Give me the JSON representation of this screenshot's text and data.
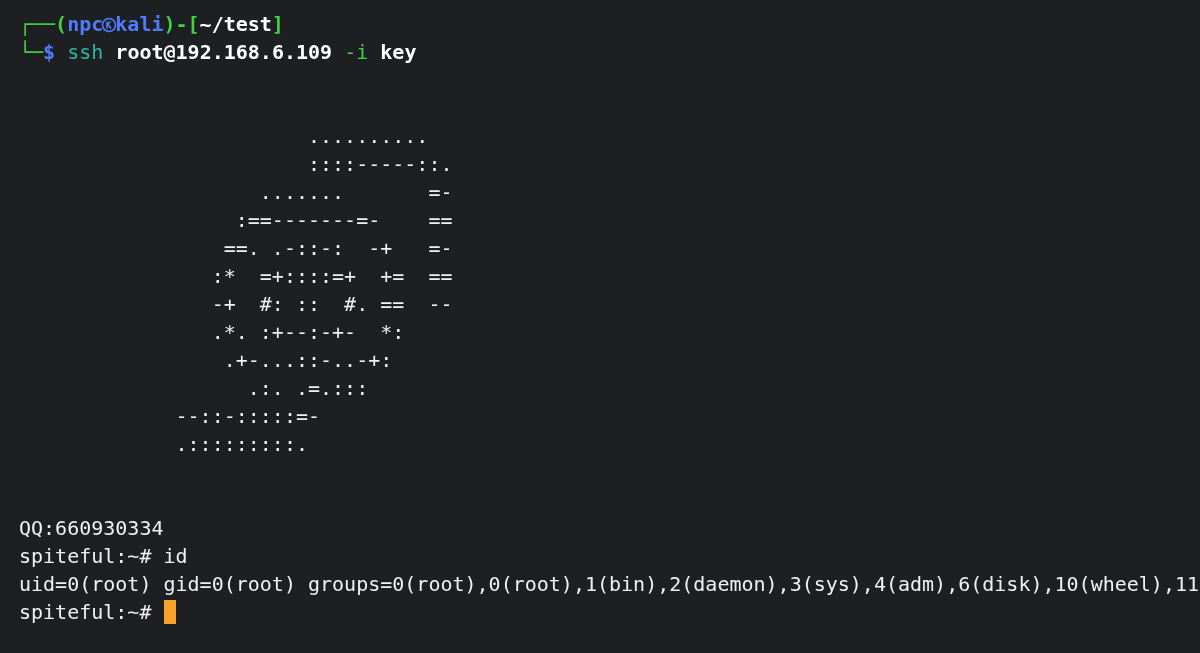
{
  "prompt": {
    "frame_top": "┌──(",
    "user": "npc",
    "host": "kali",
    "close_paren": ")-[",
    "path": "~/test",
    "close_bracket": "]",
    "frame_bottom": "└─",
    "symbol": "$",
    "command": "ssh",
    "target": "root@192.168.6.109",
    "flag": "-i",
    "flag_value": "key"
  },
  "output": [
    {
      "kind": "blank"
    },
    {
      "kind": "blank"
    },
    {
      "kind": "art",
      "text": "                        .........."
    },
    {
      "kind": "art",
      "text": "                        ::::-----::."
    },
    {
      "kind": "art",
      "text": "                    .......       =-"
    },
    {
      "kind": "art",
      "text": "                  :==-------=-    =="
    },
    {
      "kind": "art",
      "text": "                 ==. .-::-:  -+   =-"
    },
    {
      "kind": "art",
      "text": "                :*  =+::::=+  +=  =="
    },
    {
      "kind": "art",
      "text": "                -+  #: ::  #. ==  --"
    },
    {
      "kind": "art",
      "text": "                .*. :+--:-+-  *:"
    },
    {
      "kind": "art",
      "text": "                 .+-...::-..-+:"
    },
    {
      "kind": "art",
      "text": "                   .:. .=.:::"
    },
    {
      "kind": "art",
      "text": "             --::-:::::=-"
    },
    {
      "kind": "art",
      "text": "             .:::::::::."
    },
    {
      "kind": "blank"
    },
    {
      "kind": "blank"
    },
    {
      "kind": "text",
      "text": "QQ:660930334"
    },
    {
      "kind": "text",
      "text": "spiteful:~# id"
    },
    {
      "kind": "text",
      "text": "uid=0(root) gid=0(root) groups=0(root),0(root),1(bin),2(daemon),3(sys),4(adm),6(disk),10(wheel),11"
    },
    {
      "kind": "prompt",
      "text": "spiteful:~# ",
      "cursor": true
    }
  ]
}
